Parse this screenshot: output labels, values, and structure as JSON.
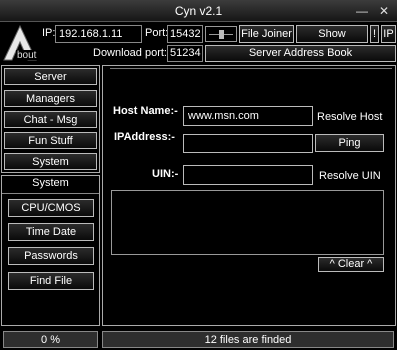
{
  "window": {
    "title": "Cyn v2.1",
    "minimize": "—",
    "close": "✕"
  },
  "logo": {
    "letter": "A",
    "text": "bout"
  },
  "header": {
    "ip_label": "IP:",
    "ip_value": "192.168.1.11",
    "port_label": "Port:",
    "port_value": "15432",
    "file_joiner": "File Joiner",
    "show_transfer": "Show Transfer",
    "excl": "!",
    "ip_btn": "IP",
    "download_port_label": "Download port:",
    "download_port_value": "51234",
    "address_book": "Server Address Book"
  },
  "sidebar": {
    "items": [
      "Server",
      "Managers",
      "Chat - Msg",
      "Fun Stuff",
      "System"
    ],
    "section_title": "System",
    "sub_items": [
      "CPU/CMOS",
      "Time Date",
      "Passwords",
      "Find File"
    ]
  },
  "main": {
    "host_label": "Host Name:-",
    "host_value": "www.msn.com",
    "resolve_host": "Resolve Host",
    "ip_label": "IPAddress:-",
    "ip_value": "",
    "ping": "Ping",
    "uin_label": "UIN:-",
    "uin_value": "",
    "resolve_uin": "Resolve UIN",
    "clear": "^ Clear ^"
  },
  "statusbar": {
    "progress": "0 %",
    "message": "12 files are finded"
  }
}
